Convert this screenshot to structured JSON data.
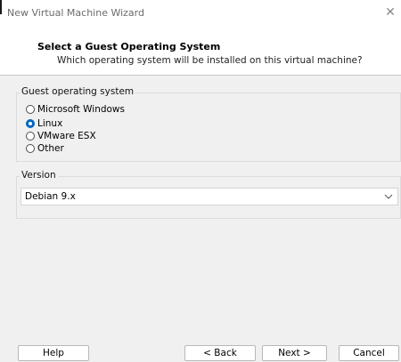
{
  "window": {
    "title": "New Virtual Machine Wizard",
    "close_glyph": "✕"
  },
  "header": {
    "title": "Select a Guest Operating System",
    "subtitle": "Which operating system will be installed on this virtual machine?"
  },
  "guest_os": {
    "group_label": "Guest operating system",
    "options": [
      {
        "label": "Microsoft Windows",
        "selected": false
      },
      {
        "label": "Linux",
        "selected": true
      },
      {
        "label": "VMware ESX",
        "selected": false
      },
      {
        "label": "Other",
        "selected": false
      }
    ]
  },
  "version": {
    "group_label": "Version",
    "value": "Debian 9.x"
  },
  "buttons": {
    "help": "Help",
    "back": "< Back",
    "next": "Next >",
    "cancel": "Cancel"
  },
  "colors": {
    "accent": "#0067c0",
    "content_bg": "#f0f0f0",
    "title_text": "#6b6b6b"
  }
}
